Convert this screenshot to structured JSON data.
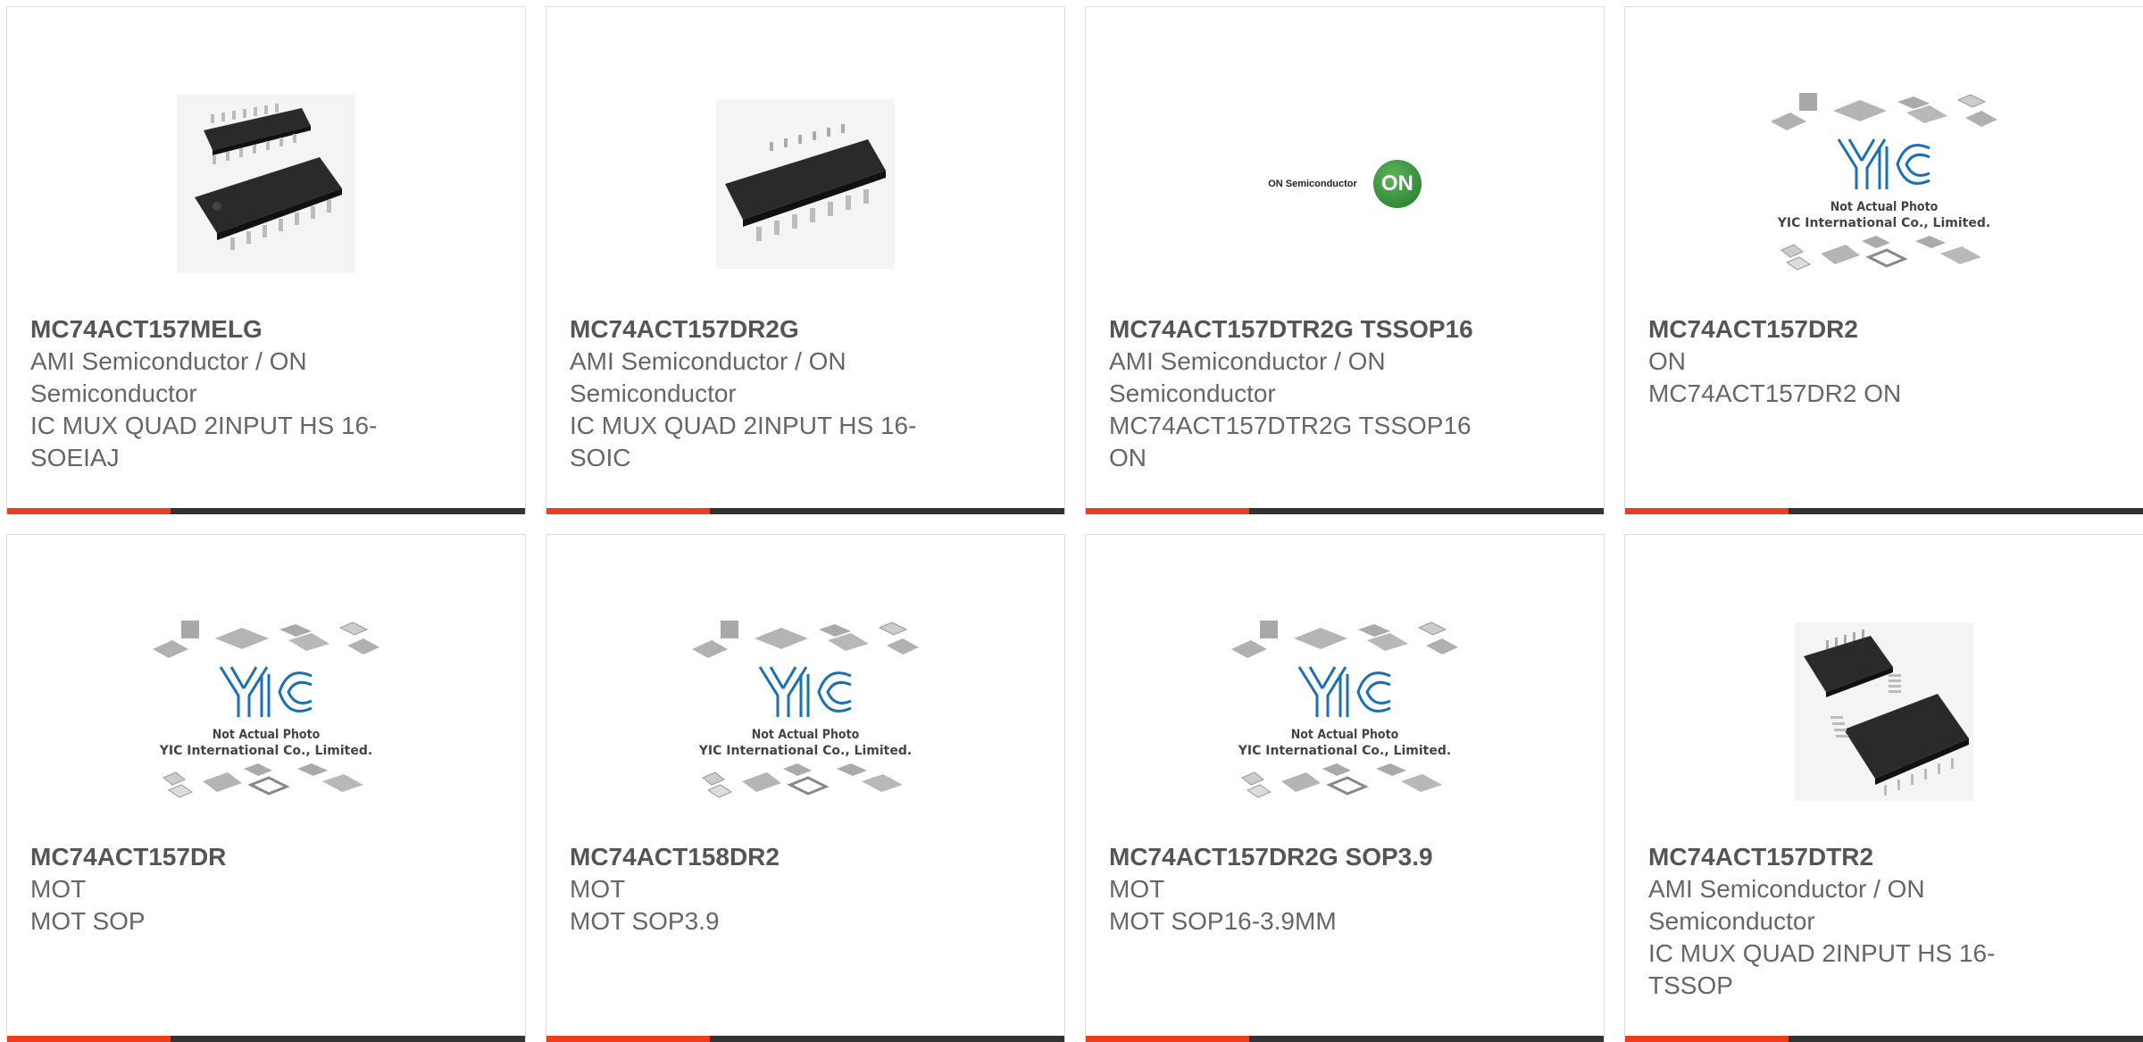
{
  "theme": {
    "accent": "#e8401c",
    "bar": "#333333"
  },
  "products": [
    {
      "part": "MC74ACT157MELG",
      "maker": "AMI Semiconductor / ON Semiconductor",
      "desc": "IC MUX QUAD 2INPUT HS 16-SOEIAJ",
      "image": "soic-dual-chip-photo"
    },
    {
      "part": "MC74ACT157DR2G",
      "maker": "AMI Semiconductor / ON Semiconductor",
      "desc": "IC MUX QUAD 2INPUT HS 16-SOIC",
      "image": "soic-chip-photo"
    },
    {
      "part": "MC74ACT157DTR2G TSSOP16",
      "maker": "AMI Semiconductor / ON Semiconductor",
      "desc": "MC74ACT157DTR2G TSSOP16 ON",
      "image": "on-semiconductor-logo",
      "logo_text": "ON Semiconductor",
      "logo_badge": "ON"
    },
    {
      "part": "MC74ACT157DR2",
      "maker": "ON",
      "desc": "MC74ACT157DR2 ON",
      "image": "yic-placeholder"
    },
    {
      "part": "MC74ACT157DR",
      "maker": "MOT",
      "desc": "MOT SOP",
      "image": "yic-placeholder"
    },
    {
      "part": "MC74ACT158DR2",
      "maker": "MOT",
      "desc": "MOT SOP3.9",
      "image": "yic-placeholder"
    },
    {
      "part": "MC74ACT157DR2G SOP3.9",
      "maker": "MOT",
      "desc": "MOT SOP16-3.9MM",
      "image": "yic-placeholder"
    },
    {
      "part": "MC74ACT157DTR2",
      "maker": "AMI Semiconductor / ON Semiconductor",
      "desc": "IC MUX QUAD 2INPUT HS 16-TSSOP",
      "image": "tssop-dual-chip-photo"
    }
  ],
  "placeholder": {
    "brand": "YIC",
    "line1": "Not Actual Photo",
    "line2": "YIC International Co., Limited."
  }
}
